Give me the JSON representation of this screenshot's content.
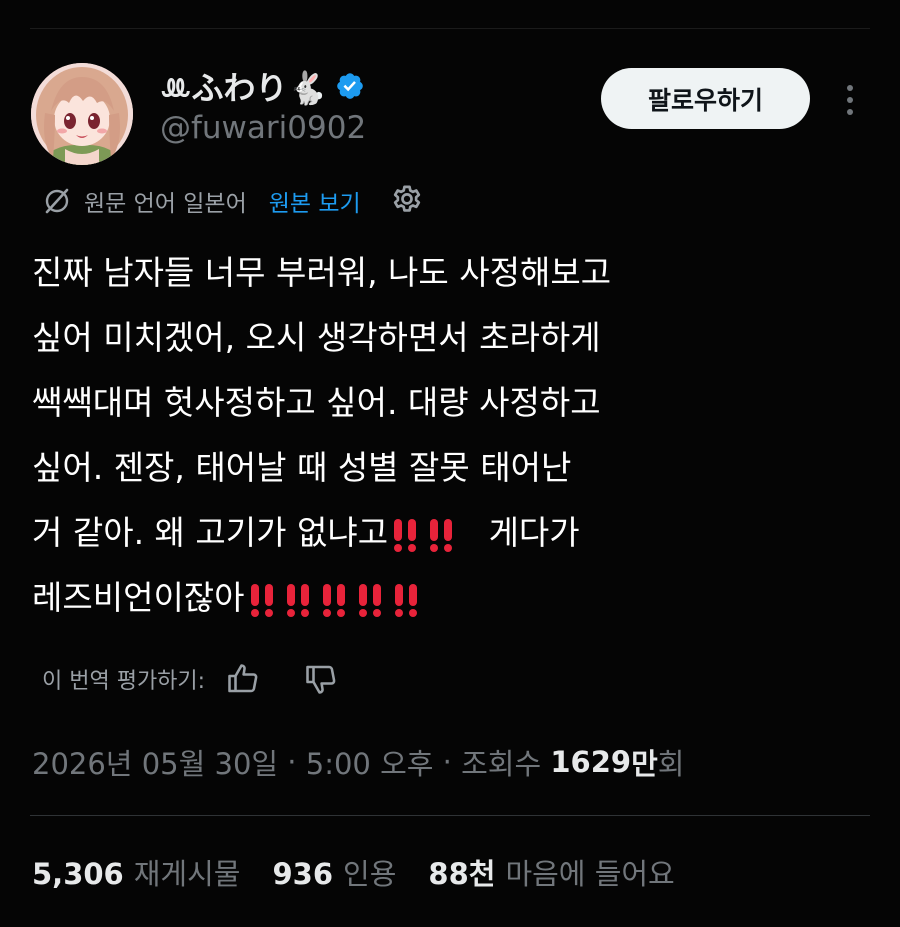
{
  "header": {
    "display_name": "ꔛふわり🐇",
    "verified_icon": "verified-badge-icon",
    "handle": "@fuwari0902",
    "follow_label": "팔로우하기",
    "more_icon": "more-options-icon",
    "avatar_icon": "anime-avatar"
  },
  "translation": {
    "icon": "translate-icon",
    "text": "원문 언어 일본어",
    "view_original": "원본 보기",
    "settings_icon": "gear-icon"
  },
  "tweet": {
    "lines": [
      "진짜 남자들 너무 부러워, 나도 사정해보고",
      "싶어 미치겠어, 오시 생각하면서 초라하게",
      "쌕쌕대며 헛사정하고 싶어. 대량 사정하고",
      "싶어. 젠장, 태어날 때 성별 잘못 태어난",
      "거 같아. 왜 고기가 없냐고",
      "게다가",
      "레즈비언이잖아"
    ],
    "emoji": "‼️"
  },
  "rate": {
    "label": "이 번역 평가하기:",
    "up_icon": "thumbs-up-icon",
    "down_icon": "thumbs-down-icon"
  },
  "meta": {
    "date": "2026년 05월 30일",
    "sep1": " · ",
    "time": "5:00 오후",
    "sep2": " · ",
    "views_label": "조회수 ",
    "views_num": "1629",
    "views_unit": "만",
    "views_suffix": "회"
  },
  "stats": {
    "reposts_num": "5,306",
    "reposts_label": "재게시물",
    "quotes_num": "936",
    "quotes_label": "인용",
    "likes_num": "88천",
    "likes_label": "마음에 들어요"
  },
  "colors": {
    "background": "#000000",
    "text": "#e7e9ea",
    "muted": "#71767b",
    "link": "#1d9bf0",
    "verified": "#1d9bf0",
    "emoji_red": "#e8233a"
  }
}
